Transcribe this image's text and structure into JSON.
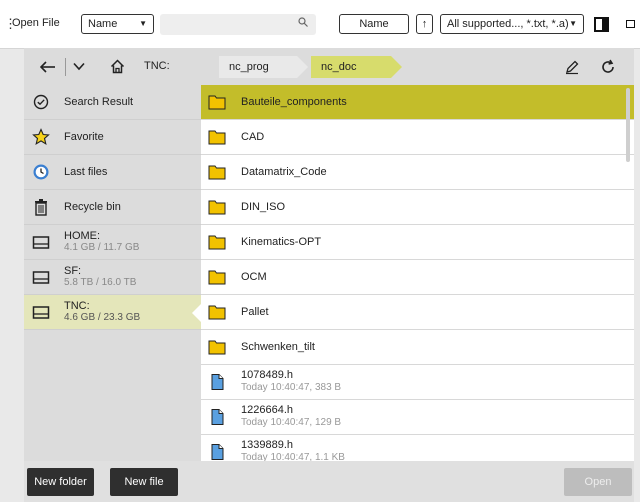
{
  "toolbar": {
    "title": "Open File",
    "sort_select": "Name",
    "search_placeholder": "",
    "sort_button": "Name",
    "sort_direction": "↑",
    "filter_select": "All supported..., *.txt, *.a)"
  },
  "breadcrumb": {
    "drive": "TNC:",
    "folders": [
      "nc_prog",
      "nc_doc"
    ]
  },
  "sidebar": {
    "items": [
      {
        "label": "Search Result",
        "icon": "check-circle-icon"
      },
      {
        "label": "Favorite",
        "icon": "star-icon"
      },
      {
        "label": "Last files",
        "icon": "clock-icon"
      },
      {
        "label": "Recycle bin",
        "icon": "trash-icon"
      },
      {
        "label": "HOME:",
        "sub": "4.1 GB / 11.7 GB",
        "icon": "drive-icon"
      },
      {
        "label": "SF:",
        "sub": "5.8 TB / 16.0 TB",
        "icon": "drive-icon"
      },
      {
        "label": "TNC:",
        "sub": "4.6 GB / 23.3 GB",
        "icon": "drive-icon"
      }
    ]
  },
  "files": [
    {
      "name": "Bauteile_components",
      "type": "folder"
    },
    {
      "name": "CAD",
      "type": "folder"
    },
    {
      "name": "Datamatrix_Code",
      "type": "folder"
    },
    {
      "name": "DIN_ISO",
      "type": "folder"
    },
    {
      "name": "Kinematics-OPT",
      "type": "folder"
    },
    {
      "name": "OCM",
      "type": "folder"
    },
    {
      "name": "Pallet",
      "type": "folder"
    },
    {
      "name": "Schwenken_tilt",
      "type": "folder"
    },
    {
      "name": "1078489.h",
      "meta": "Today 10:40:47, 383 B",
      "type": "file"
    },
    {
      "name": "1226664.h",
      "meta": "Today 10:40:47, 129 B",
      "type": "file"
    },
    {
      "name": "1339889.h",
      "meta": "Today 10:40:47, 1.1 KB",
      "type": "file"
    }
  ],
  "bottom": {
    "new_folder": "New folder",
    "new_file": "New file",
    "open": "Open"
  },
  "colors": {
    "selected_row": "#c3bd2a",
    "active_crumb": "#d7dc6c",
    "folder": "#f2c200",
    "file": "#3a8fd6"
  }
}
